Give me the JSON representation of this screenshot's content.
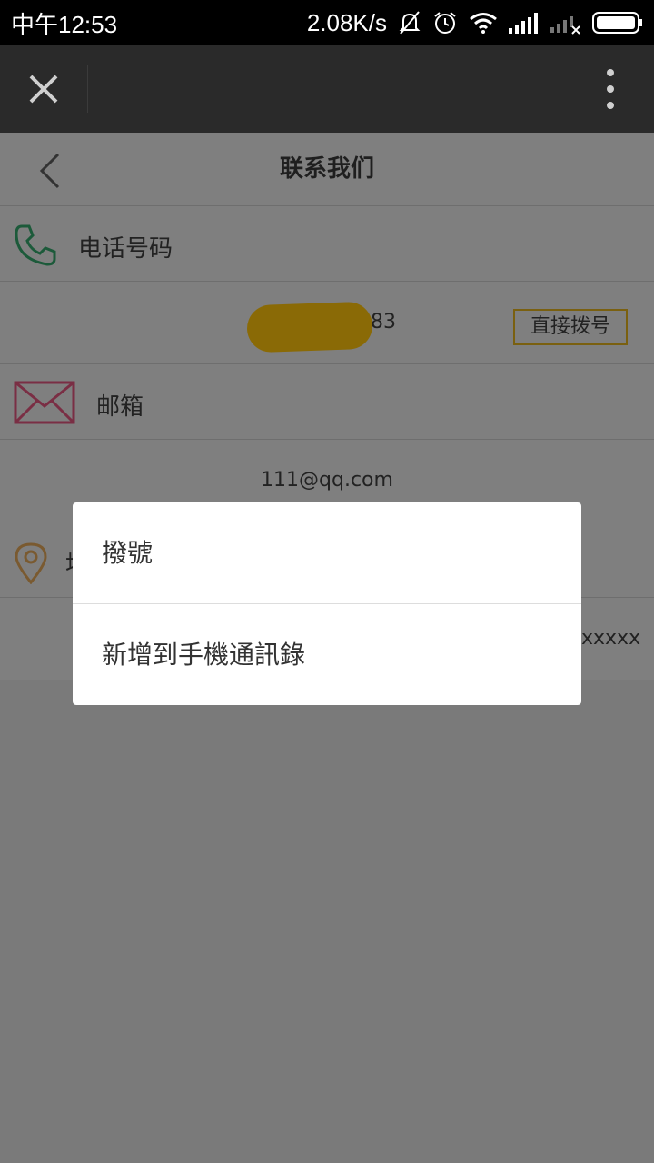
{
  "status_bar": {
    "time": "中午12:53",
    "network_speed": "2.08K/s",
    "icons": [
      "mute-bell-icon",
      "alarm-icon",
      "wifi-icon",
      "signal-icon",
      "signal-no-service-icon",
      "battery-icon"
    ]
  },
  "toolbar": {
    "close_icon": "close-icon",
    "more_icon": "more-vertical-icon"
  },
  "page": {
    "title": "联系我们",
    "phone": {
      "label": "电话号码",
      "value_suffix": "83",
      "dial_button": "直接拨号",
      "icon": "phone-icon",
      "icon_color": "#1c5a3a"
    },
    "email": {
      "label": "邮箱",
      "value": "111@qq.com",
      "icon": "mail-icon",
      "icon_color": "#7a2e44"
    },
    "address": {
      "label_partial": "地",
      "value_partial": "xxxxx",
      "icon": "location-pin-icon",
      "icon_color": "#7a5a30"
    }
  },
  "dialog": {
    "items": [
      {
        "label": "撥號"
      },
      {
        "label": "新增到手機通訊錄"
      }
    ]
  },
  "colors": {
    "overlay": "#7f7f7f",
    "status_bar": "#000000",
    "toolbar": "#2a2a2a"
  }
}
